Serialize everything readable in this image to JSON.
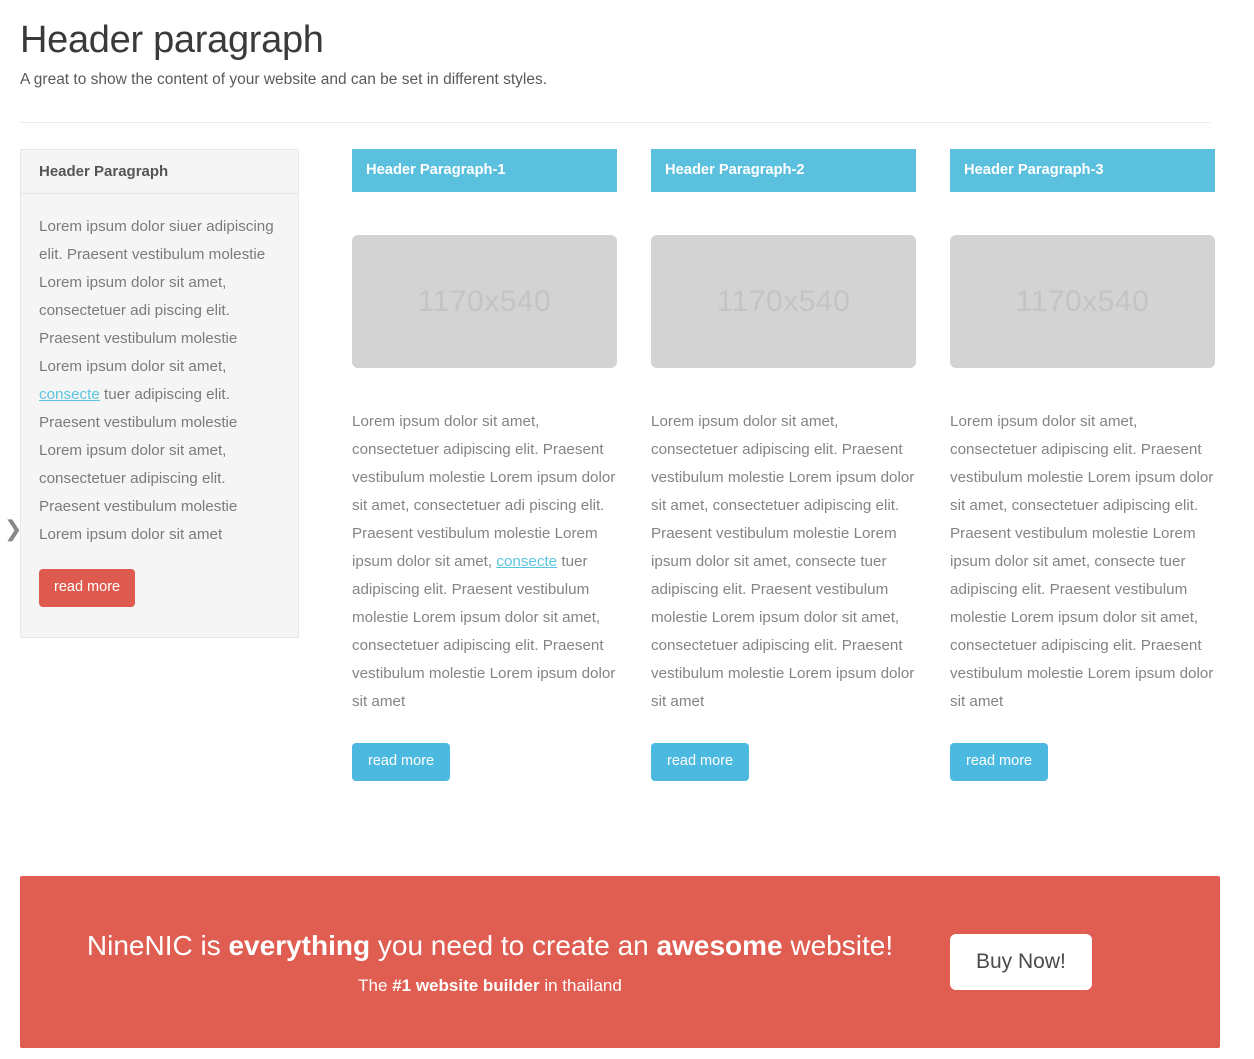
{
  "page": {
    "title": "Header paragraph",
    "subtitle": "A great to show the content of your website and can be set in different styles."
  },
  "colors": {
    "accent_blue": "#5bc0de",
    "button_blue": "#4cb9e0",
    "accent_red": "#e05d51",
    "button_red": "#df5a4e",
    "link_blue": "#5bc5e2",
    "panel_bg": "#f5f5f5",
    "thumb_bg": "#d3d3d3"
  },
  "chevron": {
    "icon": "chevron-right-icon",
    "glyph": "❯"
  },
  "sidebar": {
    "heading": "Header Paragraph",
    "body_part1": "Lorem ipsum dolor siuer adipiscing elit. Praesent vestibulum molestie Lorem ipsum dolor sit amet, consectetuer adi piscing elit. Praesent vestibulum molestie Lorem ipsum dolor sit amet, ",
    "body_link": "consecte",
    "body_part2": " tuer adipiscing elit. Praesent vestibulum molestie Lorem ipsum dolor sit amet, consectetuer adipiscing elit. Praesent vestibulum molestie Lorem ipsum dolor sit amet",
    "button_label": "read more"
  },
  "columns": [
    {
      "heading": "Header Paragraph-1",
      "thumb_label": "1170x540",
      "text_part1": "Lorem ipsum dolor sit amet, consectetuer adipiscing elit. Praesent vestibulum molestie Lorem ipsum dolor sit amet, consectetuer adi piscing elit. Praesent vestibulum molestie Lorem ipsum dolor sit amet, ",
      "text_link": "consecte",
      "text_part2": " tuer adipiscing elit. Praesent vestibulum molestie Lorem ipsum dolor sit amet, consectetuer adipiscing elit. Praesent vestibulum molestie Lorem ipsum dolor sit amet",
      "button_label": "read more"
    },
    {
      "heading": "Header Paragraph-2",
      "thumb_label": "1170x540",
      "text_part1": "Lorem ipsum dolor sit amet, consectetuer adipiscing elit. Praesent vestibulum molestie Lorem ipsum dolor sit amet, consectetuer adipiscing elit. Praesent vestibulum molestie Lorem ipsum dolor sit amet, consecte tuer adipiscing elit. Praesent vestibulum molestie Lorem ipsum dolor sit amet, consectetuer adipiscing elit. Praesent vestibulum molestie Lorem ipsum dolor sit amet",
      "text_link": "",
      "text_part2": "",
      "button_label": "read more"
    },
    {
      "heading": "Header Paragraph-3",
      "thumb_label": "1170x540",
      "text_part1": "Lorem ipsum dolor sit amet, consectetuer adipiscing elit. Praesent vestibulum molestie Lorem ipsum dolor sit amet, consectetuer adipiscing elit. Praesent vestibulum molestie Lorem ipsum dolor sit amet, consecte tuer adipiscing elit. Praesent vestibulum molestie Lorem ipsum dolor sit amet, consectetuer adipiscing elit. Praesent vestibulum molestie Lorem ipsum dolor sit amet",
      "text_link": "",
      "text_part2": "",
      "button_label": "read more"
    }
  ],
  "cta": {
    "headline_pre": "NineNIC is ",
    "headline_bold1": "everything",
    "headline_mid": " you need to create an ",
    "headline_bold2": "awesome",
    "headline_post": " website!",
    "sub_pre": "The ",
    "sub_bold": "#1 website builder",
    "sub_post": " in thailand",
    "button_label": "Buy Now!"
  }
}
